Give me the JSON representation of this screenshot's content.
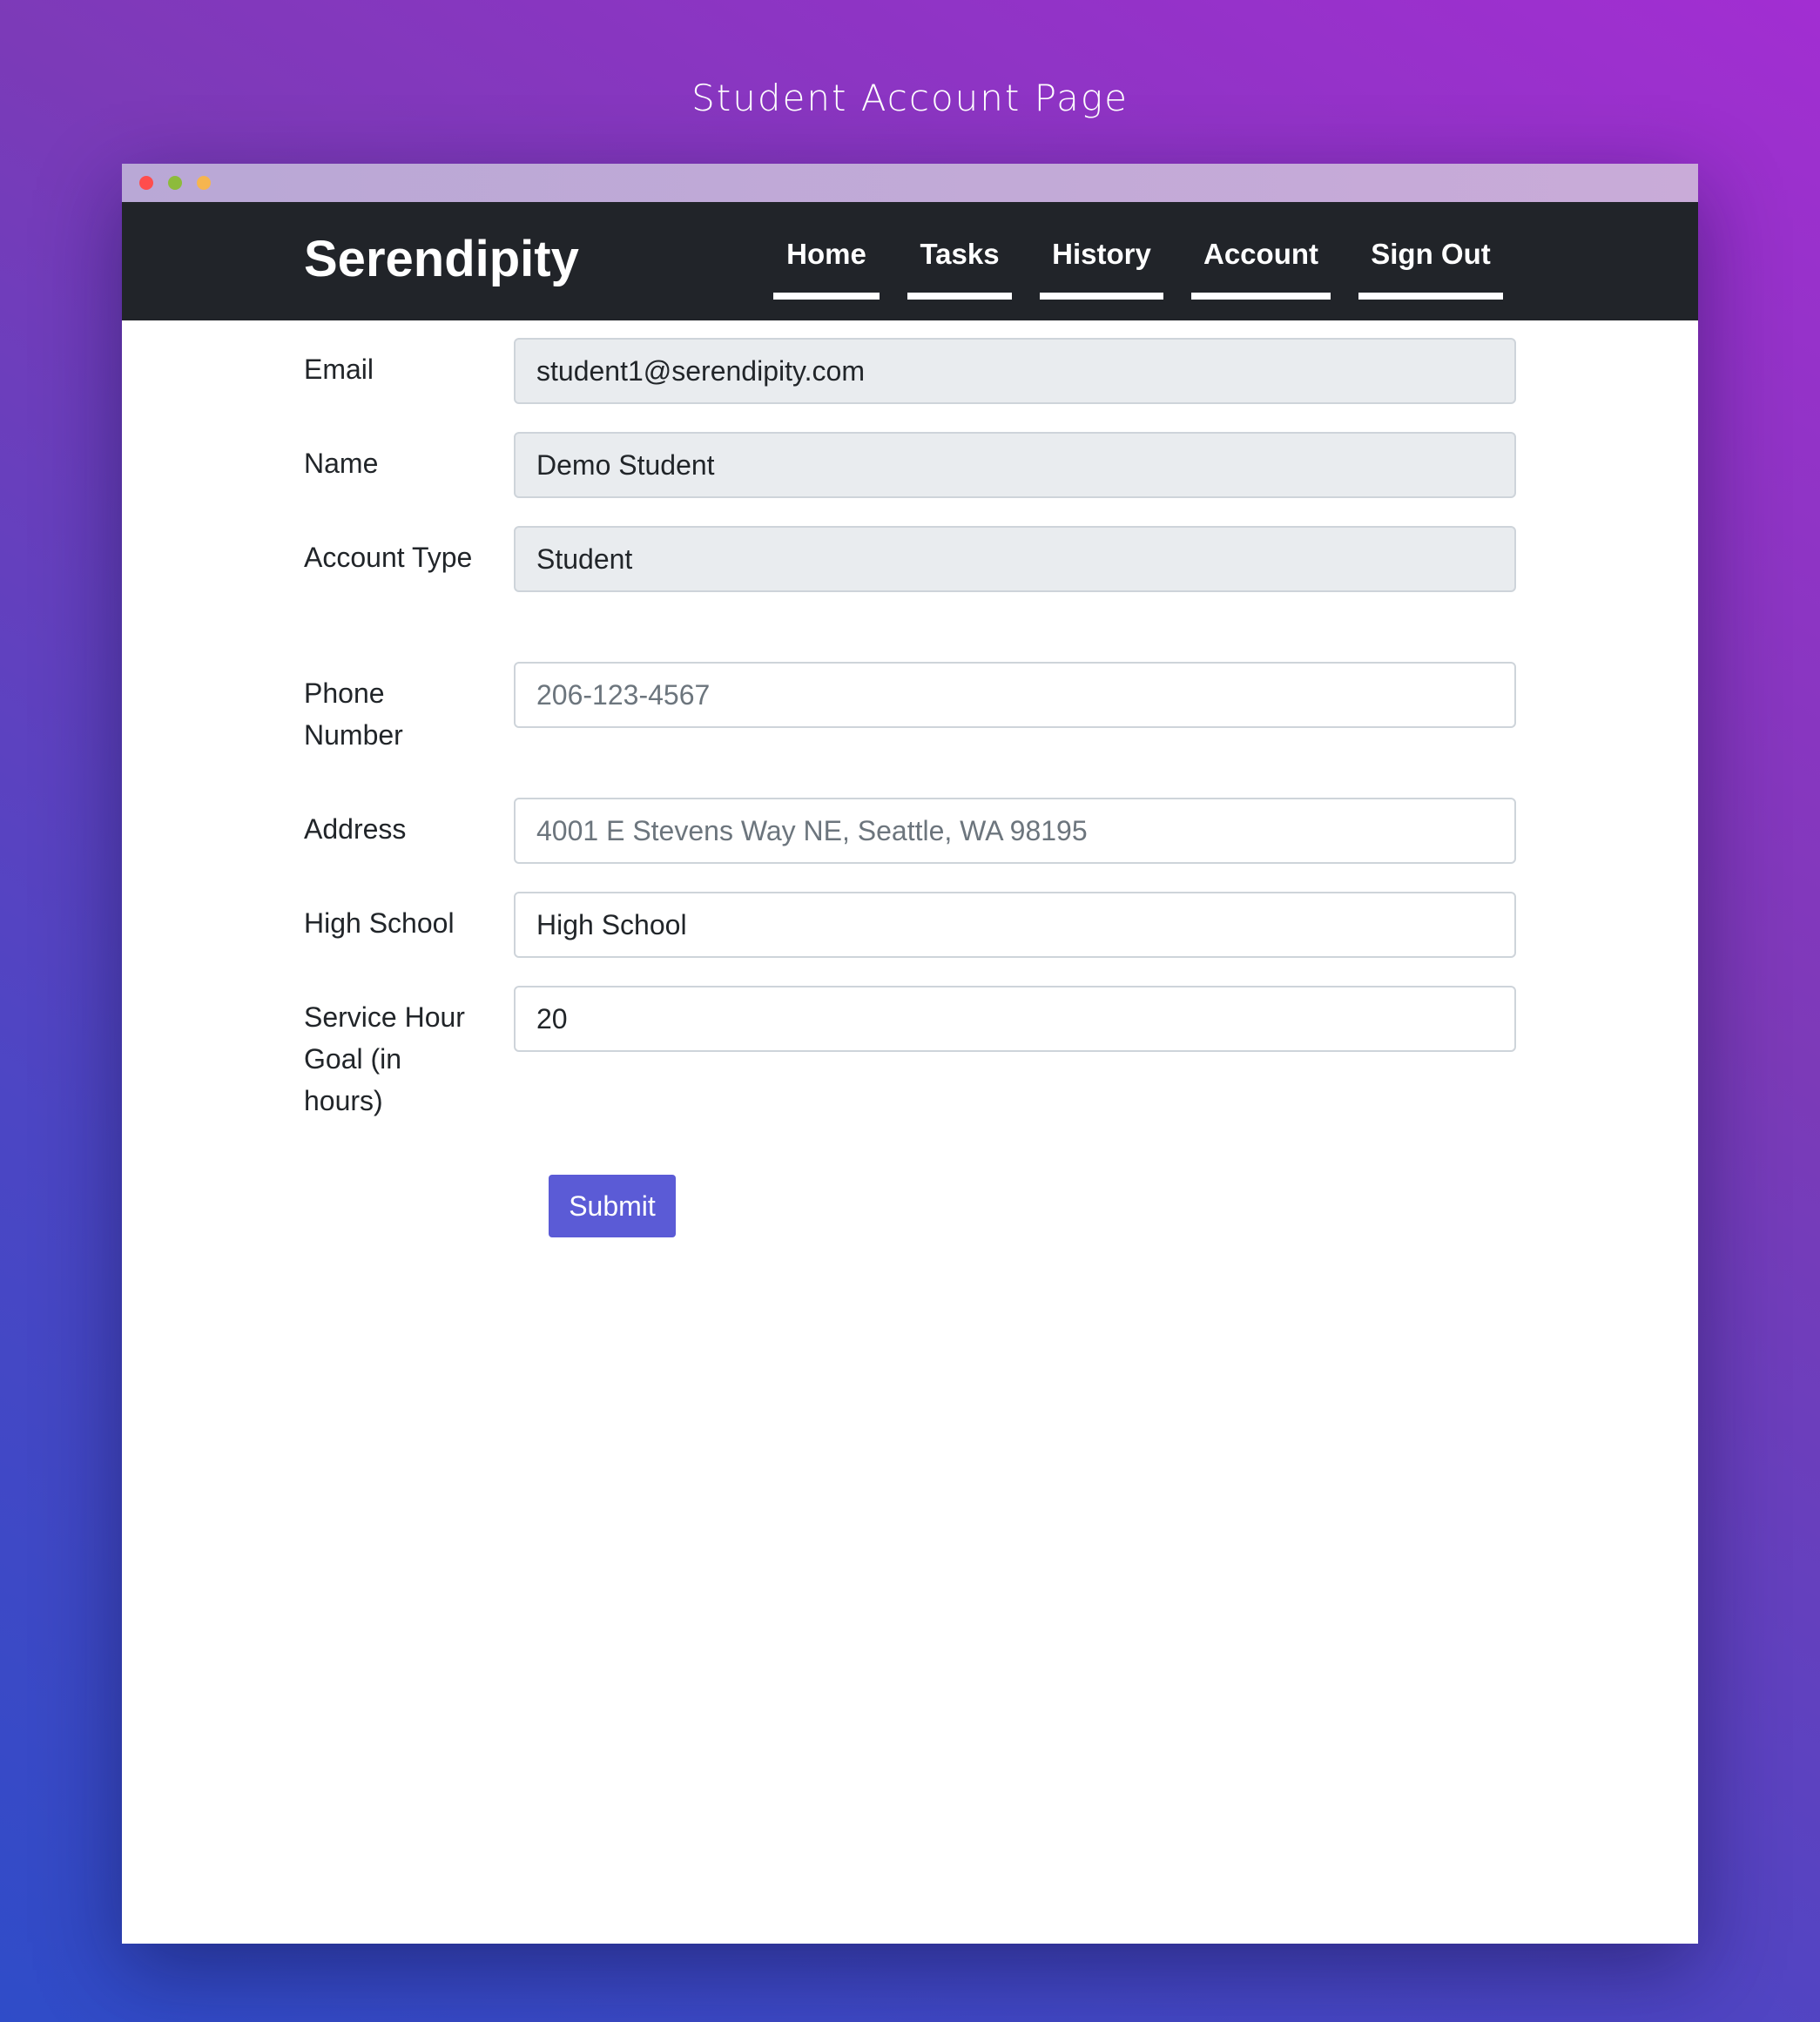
{
  "page": {
    "caption": "Student Account Page"
  },
  "window": {
    "controls": [
      "close",
      "minimize",
      "maximize"
    ]
  },
  "navbar": {
    "brand": "Serendipity",
    "items": [
      {
        "label": "Home"
      },
      {
        "label": "Tasks"
      },
      {
        "label": "History"
      },
      {
        "label": "Account"
      },
      {
        "label": "Sign Out"
      }
    ]
  },
  "form": {
    "fields": [
      {
        "label": "Email",
        "value": "student1@serendipity.com",
        "placeholder": "",
        "readonly": true
      },
      {
        "label": "Name",
        "value": "Demo Student",
        "placeholder": "",
        "readonly": true
      },
      {
        "label": "Account Type",
        "value": "Student",
        "placeholder": "",
        "readonly": true
      },
      {
        "label": "Phone Number",
        "value": "",
        "placeholder": "206-123-4567",
        "readonly": false
      },
      {
        "label": "Address",
        "value": "",
        "placeholder": "4001 E Stevens Way NE, Seattle, WA 98195",
        "readonly": false
      },
      {
        "label": "High School",
        "value": "High School",
        "placeholder": "",
        "readonly": false
      },
      {
        "label": "Service Hour Goal (in hours)",
        "value": "20",
        "placeholder": "",
        "readonly": false
      }
    ],
    "submit_label": "Submit"
  },
  "colors": {
    "navbar_bg": "#212429",
    "submit_bg": "#5b5bd6",
    "readonly_bg": "#e9ecef"
  }
}
